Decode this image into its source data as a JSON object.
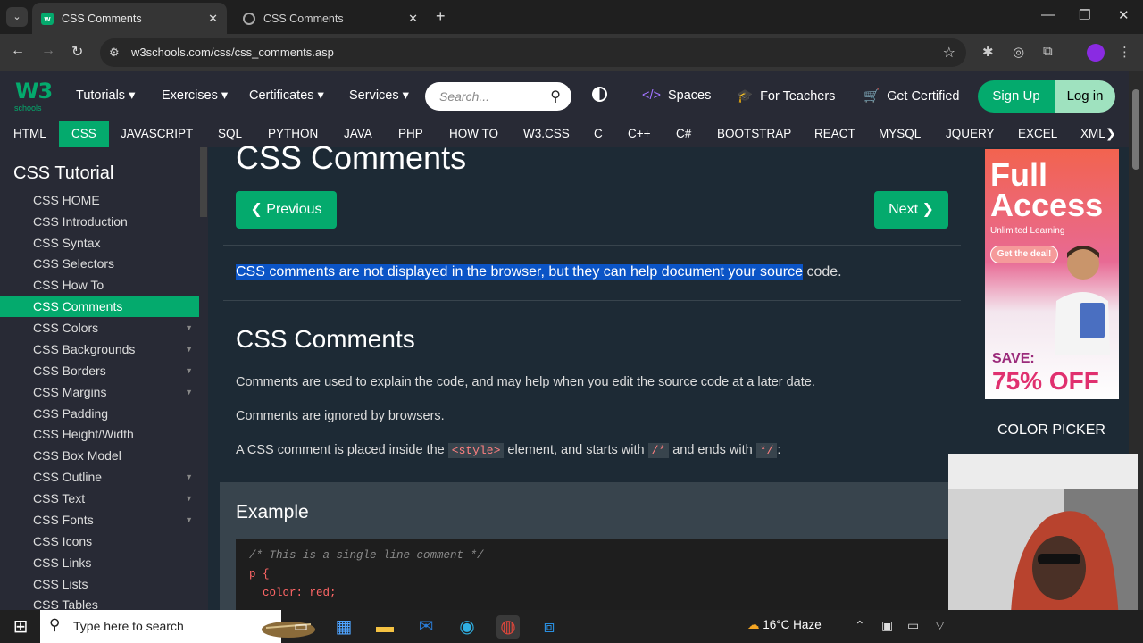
{
  "browser": {
    "tabs": [
      {
        "title": "CSS Comments",
        "active": true
      },
      {
        "title": "CSS Comments",
        "active": false
      }
    ],
    "url": "w3schools.com/css/css_comments.asp"
  },
  "topnav": {
    "logo_big": "W3",
    "logo_small": "schools",
    "menus": [
      "Tutorials ▾",
      "Exercises ▾",
      "Certificates ▾",
      "Services ▾"
    ],
    "search_placeholder": "Search...",
    "spaces": "Spaces",
    "for_teachers": "For Teachers",
    "get_certified": "Get Certified",
    "sign_up": "Sign Up",
    "log_in": "Log in"
  },
  "subnav": {
    "items": [
      "HTML",
      "CSS",
      "JAVASCRIPT",
      "SQL",
      "PYTHON",
      "JAVA",
      "PHP",
      "HOW TO",
      "W3.CSS",
      "C",
      "C++",
      "C#",
      "BOOTSTRAP",
      "REACT",
      "MYSQL",
      "JQUERY",
      "EXCEL",
      "XML"
    ],
    "active": "CSS"
  },
  "sidebar": {
    "title": "CSS Tutorial",
    "items": [
      {
        "label": "CSS HOME"
      },
      {
        "label": "CSS Introduction"
      },
      {
        "label": "CSS Syntax"
      },
      {
        "label": "CSS Selectors"
      },
      {
        "label": "CSS How To"
      },
      {
        "label": "CSS Comments"
      },
      {
        "label": "CSS Colors"
      },
      {
        "label": "CSS Backgrounds"
      },
      {
        "label": "CSS Borders"
      },
      {
        "label": "CSS Margins"
      },
      {
        "label": "CSS Padding"
      },
      {
        "label": "CSS Height/Width"
      },
      {
        "label": "CSS Box Model"
      },
      {
        "label": "CSS Outline"
      },
      {
        "label": "CSS Text"
      },
      {
        "label": "CSS Fonts"
      },
      {
        "label": "CSS Icons"
      },
      {
        "label": "CSS Links"
      },
      {
        "label": "CSS Lists"
      },
      {
        "label": "CSS Tables"
      }
    ],
    "active_item": "CSS Comments"
  },
  "main": {
    "heading": "CSS Comments",
    "previous": "❮ Previous",
    "next": "Next ❯",
    "intro_selected": "CSS comments are not displayed in the browser, but they can help document your source",
    "intro_rest": " code.",
    "subheading": "CSS Comments",
    "para1": "Comments are used to explain the code, and may help when you edit the source code at a later date.",
    "para2": "Comments are ignored by browsers.",
    "para3_a": "A CSS comment is placed inside the ",
    "para3_code1": "<style>",
    "para3_b": " element, and starts with ",
    "para3_code2": "/*",
    "para3_c": " and ends with ",
    "para3_code3": "*/",
    "para3_d": ":",
    "example_title": "Example",
    "code_lines": [
      "/* This is a single-line comment */",
      "p {",
      "  color: red;"
    ]
  },
  "ad": {
    "headline": "Full Access",
    "sub": "Unlimited Learning",
    "cta": "Get the deal!",
    "save": "SAVE:",
    "discount": "75% OFF"
  },
  "right_col": {
    "color_picker": "COLOR PICKER"
  },
  "taskbar": {
    "search_placeholder": "Type here to search",
    "weather": "16°C  Haze"
  }
}
